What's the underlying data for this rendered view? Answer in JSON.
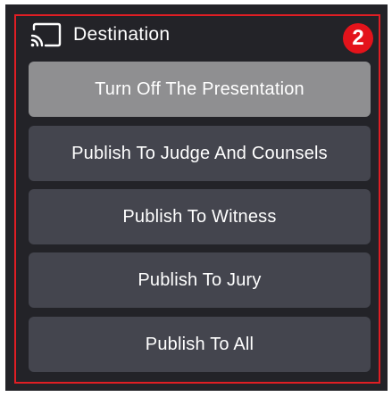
{
  "destination": {
    "title": "Destination",
    "icon": "cast-icon",
    "badge": "2",
    "colors": {
      "panel_bg": "#232328",
      "button_bg": "#44454e",
      "active_button_bg": "#8f8f91",
      "highlight": "#e01e24",
      "badge_bg": "#e4131b"
    },
    "buttons": [
      {
        "label": "Turn Off The Presentation",
        "state": "active"
      },
      {
        "label": "Publish To Judge And Counsels",
        "state": "default"
      },
      {
        "label": "Publish To Witness",
        "state": "default"
      },
      {
        "label": "Publish To Jury",
        "state": "default"
      },
      {
        "label": "Publish To All",
        "state": "default"
      }
    ]
  }
}
